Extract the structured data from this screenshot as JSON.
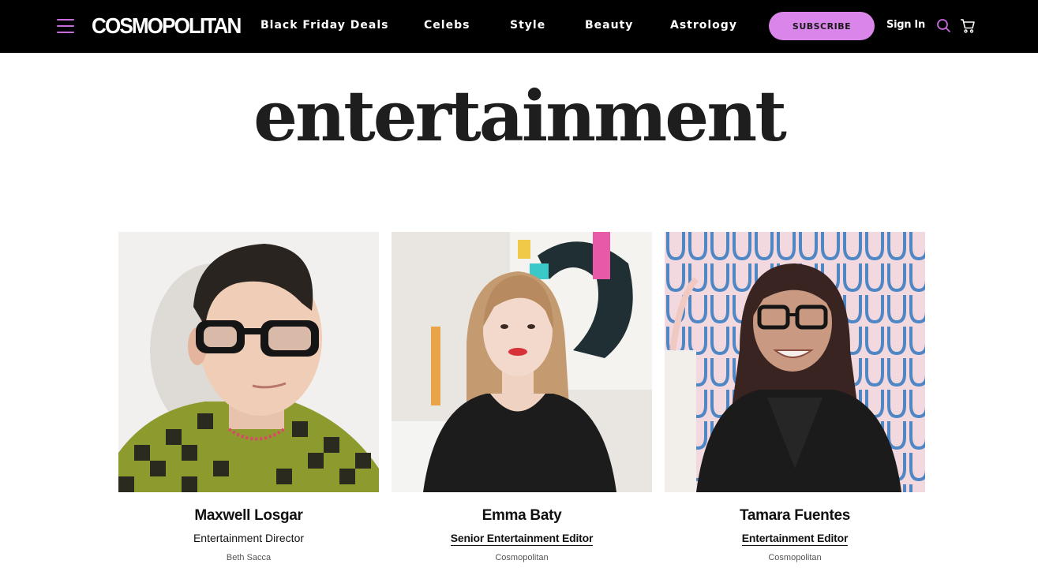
{
  "nav": {
    "logo": "COSMOPOLITAN",
    "links": [
      "Black Friday Deals",
      "Celebs",
      "Style",
      "Beauty",
      "Astrology"
    ],
    "subscribe_label": "SUBSCRIBE",
    "signin_label": "Sign In",
    "icons": [
      "menu-icon",
      "search-icon",
      "cart-icon"
    ],
    "accent_color": "#da85ea"
  },
  "page": {
    "title": "entertainment"
  },
  "staff": [
    {
      "name": "Maxwell Losgar",
      "role": "Entertainment Director",
      "role_linked": false,
      "credit": "Beth Sacca"
    },
    {
      "name": "Emma Baty",
      "role": "Senior Entertainment Editor",
      "role_linked": true,
      "credit": "Cosmopolitan"
    },
    {
      "name": "Tamara Fuentes",
      "role": "Entertainment Editor",
      "role_linked": true,
      "credit": "Cosmopolitan"
    }
  ]
}
